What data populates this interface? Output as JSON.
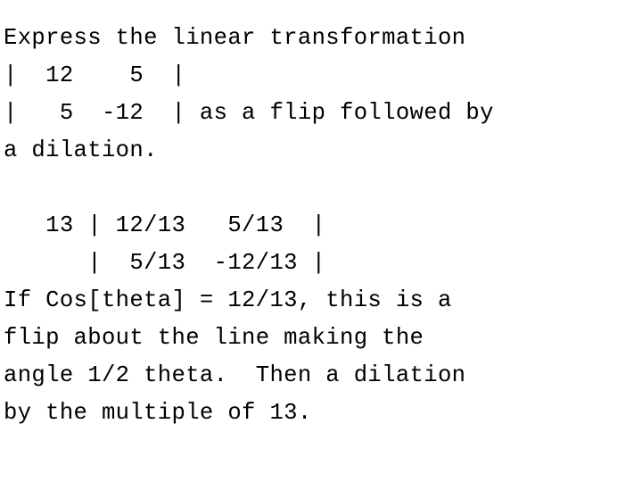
{
  "slide": {
    "background_color": "#ffffff",
    "text_color": "#000000",
    "topic": "linear-algebra-flip-and-dilation",
    "lines": [
      {
        "id": "line-1",
        "text": "Express the linear transformation"
      },
      {
        "id": "line-2",
        "text": "|  12    5  |"
      },
      {
        "id": "line-3",
        "text": "|   5  -12  | as a flip followed by"
      },
      {
        "id": "line-4",
        "text": "a dilation."
      },
      {
        "id": "line-5",
        "text": ""
      },
      {
        "id": "line-6",
        "text": "   13 | 12/13   5/13  |"
      },
      {
        "id": "line-7",
        "text": "      |  5/13  -12/13 |"
      },
      {
        "id": "line-8",
        "text": "If Cos[theta] = 12/13, this is a"
      },
      {
        "id": "line-9",
        "text": "flip about the line making the"
      },
      {
        "id": "line-10",
        "text": "angle 1/2 theta.  Then a dilation"
      },
      {
        "id": "line-11",
        "text": "by the multiple of 13."
      }
    ],
    "problem_statement": "Express the linear transformation | 12 5 | | 5 -12 | as a flip followed by a dilation.",
    "matrix_original": {
      "row1": [
        "12",
        "5"
      ],
      "row2": [
        "5",
        "-12"
      ]
    },
    "scalar_factor": "13",
    "matrix_normalized": {
      "row1": [
        "12/13",
        "5/13"
      ],
      "row2": [
        "5/13",
        "-12/13"
      ]
    },
    "cosine_value": "12/13",
    "flip_angle": "1/2 theta",
    "dilation_multiple": "13"
  }
}
